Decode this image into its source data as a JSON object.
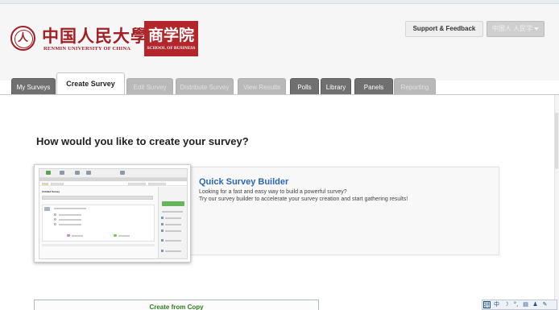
{
  "header": {
    "university_cn": "中国人民大學",
    "university_en": "RENMIN UNIVERSITY OF CHINA",
    "school_cn": "商学院",
    "school_en": "SCHOOL OF BUSINESS",
    "support_label": "Support & Feedback",
    "user_label": "中国人 人民学"
  },
  "tabs": [
    {
      "label": "My Surveys",
      "state": "normal"
    },
    {
      "label": "Create Survey",
      "state": "active"
    },
    {
      "label": "Edit Survey",
      "state": "disabled"
    },
    {
      "label": "Distribute Survey",
      "state": "disabled"
    },
    {
      "label": "View Results",
      "state": "disabled"
    },
    {
      "label": "Polls",
      "state": "normal"
    },
    {
      "label": "Library",
      "state": "normal"
    },
    {
      "label": "Panels",
      "state": "normal"
    },
    {
      "label": "Reporting",
      "state": "disabled"
    }
  ],
  "main": {
    "question": "How would you like to create your survey?",
    "options": [
      {
        "title": "Quick Survey Builder",
        "description_line1": "Looking for a fast and easy way to build a powerful survey?",
        "description_line2": "Try our survey builder to accelerate your survey creation and start gathering results!",
        "thumbnail_title": "Untitled Survey"
      },
      {
        "title": "Create from Copy"
      }
    ]
  },
  "ime_toolbar": {
    "icons": [
      "mode-icon",
      "chinese-icon",
      "moon-icon",
      "punctuation-icon",
      "keyboard-icon",
      "user-icon",
      "wrench-icon"
    ],
    "glyphs": [
      "拼",
      "中",
      "☽",
      "°,",
      "▤",
      "♟",
      "✎"
    ]
  },
  "colors": {
    "brand_red": "#b3262b",
    "link_blue": "#2b67b6",
    "tab_dark": "#707070",
    "tab_disabled": "#b9b9b9",
    "copy_green": "#2e7a1f"
  }
}
